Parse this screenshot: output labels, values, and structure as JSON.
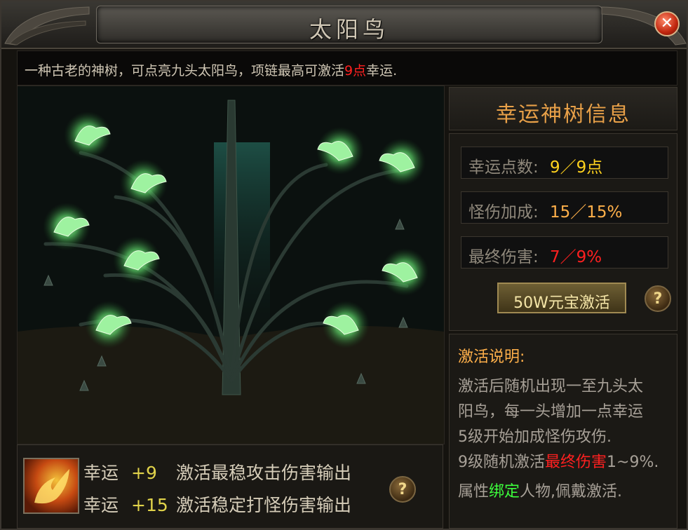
{
  "window": {
    "title": "太阳鸟",
    "close_icon": "close-icon"
  },
  "description": {
    "prefix": "一种古老的神树，可点亮九头太阳鸟，项链最高可激活",
    "highlight": "9点",
    "suffix": "幸运."
  },
  "info_panel": {
    "header": "幸运神树信息",
    "stats": [
      {
        "key": "幸运点数:",
        "value": "9／9点",
        "color": "#ffd21e"
      },
      {
        "key": "怪伤加成:",
        "value": "15／15%",
        "color": "#ffb04a"
      },
      {
        "key": "最终伤害:",
        "value": "7／9%",
        "color": "#ff2020"
      }
    ],
    "activate_button": "50W元宝激活",
    "help_icon": "?"
  },
  "notes": {
    "title": "激活说明:",
    "line1": "激活后随机出现一至九头太",
    "line2": "阳鸟，每一头增加一点幸运",
    "line3": "5级开始加成怪伤攻伤.",
    "line4_prefix": "9级随机激活",
    "line4_highlight": "最终伤害",
    "line4_suffix": "1~9%.",
    "line5_prefix": "属性",
    "line5_highlight": "绑定",
    "line5_suffix": "人物,佩戴激活."
  },
  "bonus": {
    "rows": [
      {
        "label": "幸运",
        "value": "+9",
        "text": "激活最稳攻击伤害输出"
      },
      {
        "label": "幸运",
        "value": "+15",
        "text": "激活稳定打怪伤害输出"
      }
    ],
    "help_icon": "?"
  },
  "tree": {
    "lit_birds": 9
  },
  "colors": {
    "gold_text": "#ffd21e",
    "red_text": "#ff2020",
    "green_text": "#3cff3c",
    "header_orange": "#e8a048"
  }
}
